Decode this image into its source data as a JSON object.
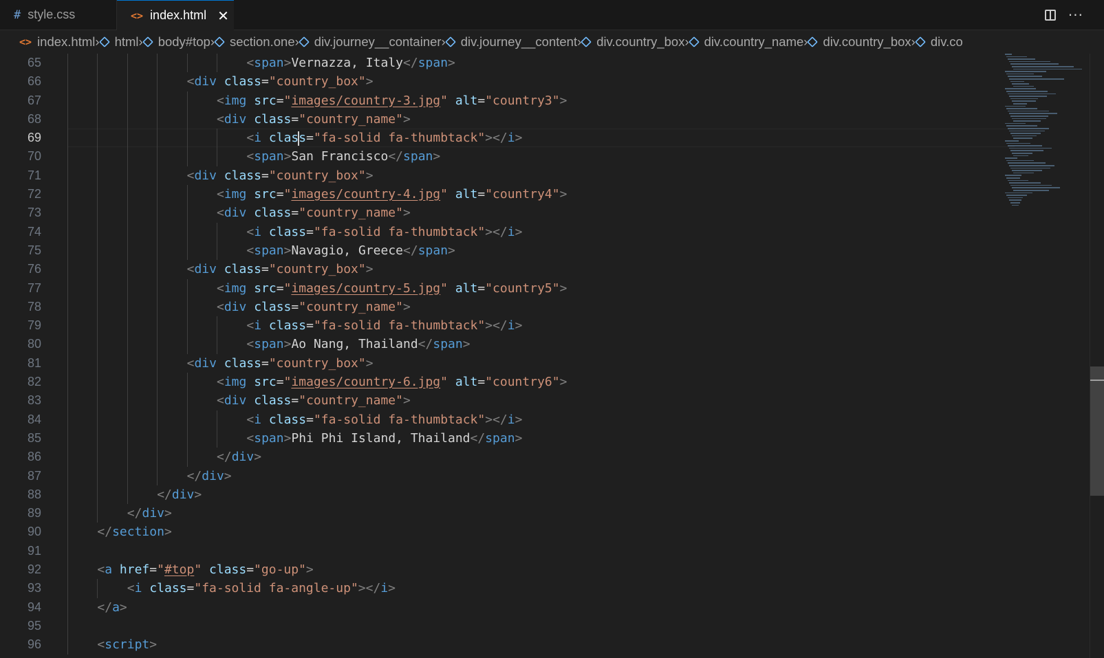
{
  "tabs": [
    {
      "label": "style.css",
      "icon": "hash-icon",
      "active": false
    },
    {
      "label": "index.html",
      "icon": "html-angle-icon",
      "active": true
    }
  ],
  "tab_icons": {
    "css": "#",
    "html": "<>",
    "close": "✕",
    "more": "···"
  },
  "breadcrumb": [
    "index.html",
    "html",
    "body#top",
    "section.one",
    "div.journey__container",
    "div.journey__content",
    "div.country_box",
    "div.country_name",
    "div.country_box",
    "div.co"
  ],
  "current_line": 69,
  "line_numbers": [
    "65",
    "66",
    "67",
    "68",
    "69",
    "70",
    "71",
    "72",
    "73",
    "74",
    "75",
    "76",
    "77",
    "78",
    "79",
    "80",
    "81",
    "82",
    "83",
    "84",
    "85",
    "86",
    "87",
    "88",
    "89",
    "90",
    "91",
    "92",
    "93",
    "94",
    "95",
    "96"
  ],
  "code_lines": [
    "<span>Vernazza, Italy</span>",
    "<div class=\"country_box\">",
    "<img src=\"images/country-3.jpg\" alt=\"country3\">",
    "<div class=\"country_name\">",
    "<i class=\"fa-solid fa-thumbtack\"></i>",
    "<span>San Francisco</span>",
    "<div class=\"country_box\">",
    "<img src=\"images/country-4.jpg\" alt=\"country4\">",
    "<div class=\"country_name\">",
    "<i class=\"fa-solid fa-thumbtack\"></i>",
    "<span>Navagio, Greece</span>",
    "<div class=\"country_box\">",
    "<img src=\"images/country-5.jpg\" alt=\"country5\">",
    "<div class=\"country_name\">",
    "<i class=\"fa-solid fa-thumbtack\"></i>",
    "<span>Ao Nang, Thailand</span>",
    "<div class=\"country_box\">",
    "<img src=\"images/country-6.jpg\" alt=\"country6\">",
    "<div class=\"country_name\">",
    "<i class=\"fa-solid fa-thumbtack\"></i>",
    "<span>Phi Phi Island, Thailand</span>",
    "</div>",
    "</div>",
    "</div>",
    "</div>",
    "</section>",
    "",
    "<a href=\"#top\" class=\"go-up\">",
    "<i class=\"fa-solid fa-angle-up\"></i>",
    "</a>",
    "",
    "<script>"
  ],
  "theme": {
    "background": "#1f1f1f",
    "tag": "#569cd6",
    "attribute": "#9cdcfe",
    "string": "#ce9178",
    "text": "#d4d4d4",
    "active_tab_accent": "#0078d4"
  }
}
